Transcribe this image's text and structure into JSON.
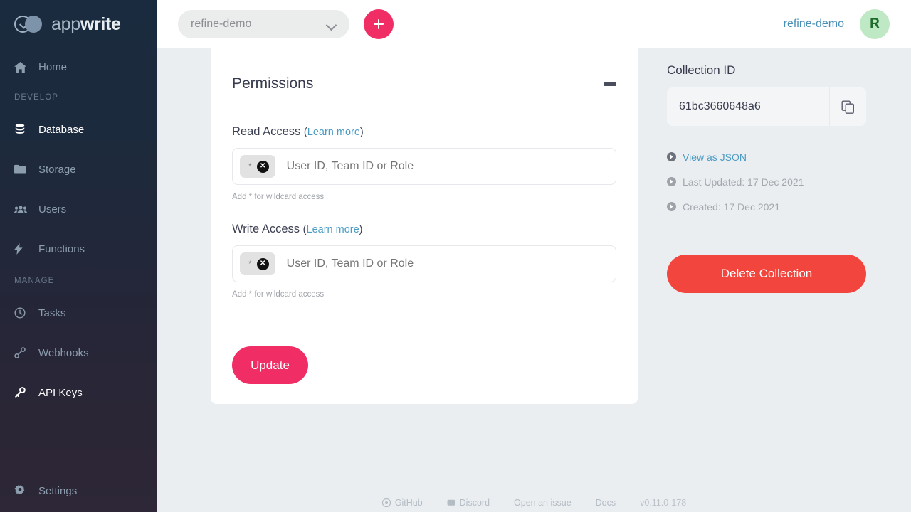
{
  "brand": {
    "light": "app",
    "bold": "write"
  },
  "sidebar": {
    "sections": [
      {
        "label": "DEVELOP"
      },
      {
        "label": "MANAGE"
      }
    ],
    "home": {
      "label": "Home",
      "icon": "home-icon"
    },
    "develop_items": [
      {
        "label": "Database",
        "icon": "database-icon",
        "active": true
      },
      {
        "label": "Storage",
        "icon": "folder-icon",
        "active": false
      },
      {
        "label": "Users",
        "icon": "users-icon",
        "active": false
      },
      {
        "label": "Functions",
        "icon": "bolt-icon",
        "active": false
      }
    ],
    "manage_items": [
      {
        "label": "Tasks",
        "icon": "clock-icon",
        "active": false
      },
      {
        "label": "Webhooks",
        "icon": "link-icon",
        "active": false
      },
      {
        "label": "API Keys",
        "icon": "key-icon",
        "active": true
      }
    ],
    "settings": {
      "label": "Settings",
      "icon": "gear-icon"
    }
  },
  "topbar": {
    "project_select": {
      "value": "refine-demo",
      "icon": "chevron-down-icon"
    },
    "add_button": {
      "icon": "plus-icon",
      "color": "#f02e65"
    },
    "project_link": "refine-demo",
    "avatar": {
      "initial": "R",
      "bg": "#bfe9c4",
      "fg": "#1e6b2c"
    }
  },
  "permissions": {
    "title": "Permissions",
    "collapse_icon": "minus-icon",
    "read": {
      "label": "Read Access",
      "learn_more": "Learn more",
      "paren_open": "(",
      "paren_close": ")",
      "tag": "*",
      "tag_remove_icon": "close-circle-icon",
      "placeholder": "User ID, Team ID or Role",
      "hint": "Add * for wildcard access"
    },
    "write": {
      "label": "Write Access",
      "learn_more": "Learn more",
      "paren_open": "(",
      "paren_close": ")",
      "tag": "*",
      "tag_remove_icon": "close-circle-icon",
      "placeholder": "User ID, Team ID or Role",
      "hint": "Add * for wildcard access"
    },
    "update_button": {
      "label": "Update",
      "color": "#f02e65"
    }
  },
  "side_panel": {
    "title": "Collection ID",
    "collection_id": "61bc3660648a6",
    "copy_icon": "copy-icon",
    "links": [
      {
        "label": "View as JSON",
        "type": "link",
        "icon": "arrow-circle-icon"
      },
      {
        "label": "Last Updated: 17 Dec 2021",
        "type": "plain",
        "icon": "arrow-circle-icon"
      },
      {
        "label": "Created: 17 Dec 2021",
        "type": "plain",
        "icon": "arrow-circle-icon"
      }
    ],
    "delete_button": {
      "label": "Delete Collection",
      "color": "#f1453d"
    }
  },
  "footer": {
    "items": [
      {
        "label": "GitHub",
        "icon": "github-icon"
      },
      {
        "label": "Discord",
        "icon": "discord-icon"
      },
      {
        "label": "Open an issue",
        "icon": ""
      },
      {
        "label": "Docs",
        "icon": ""
      }
    ],
    "version": "v0.11.0-178"
  }
}
